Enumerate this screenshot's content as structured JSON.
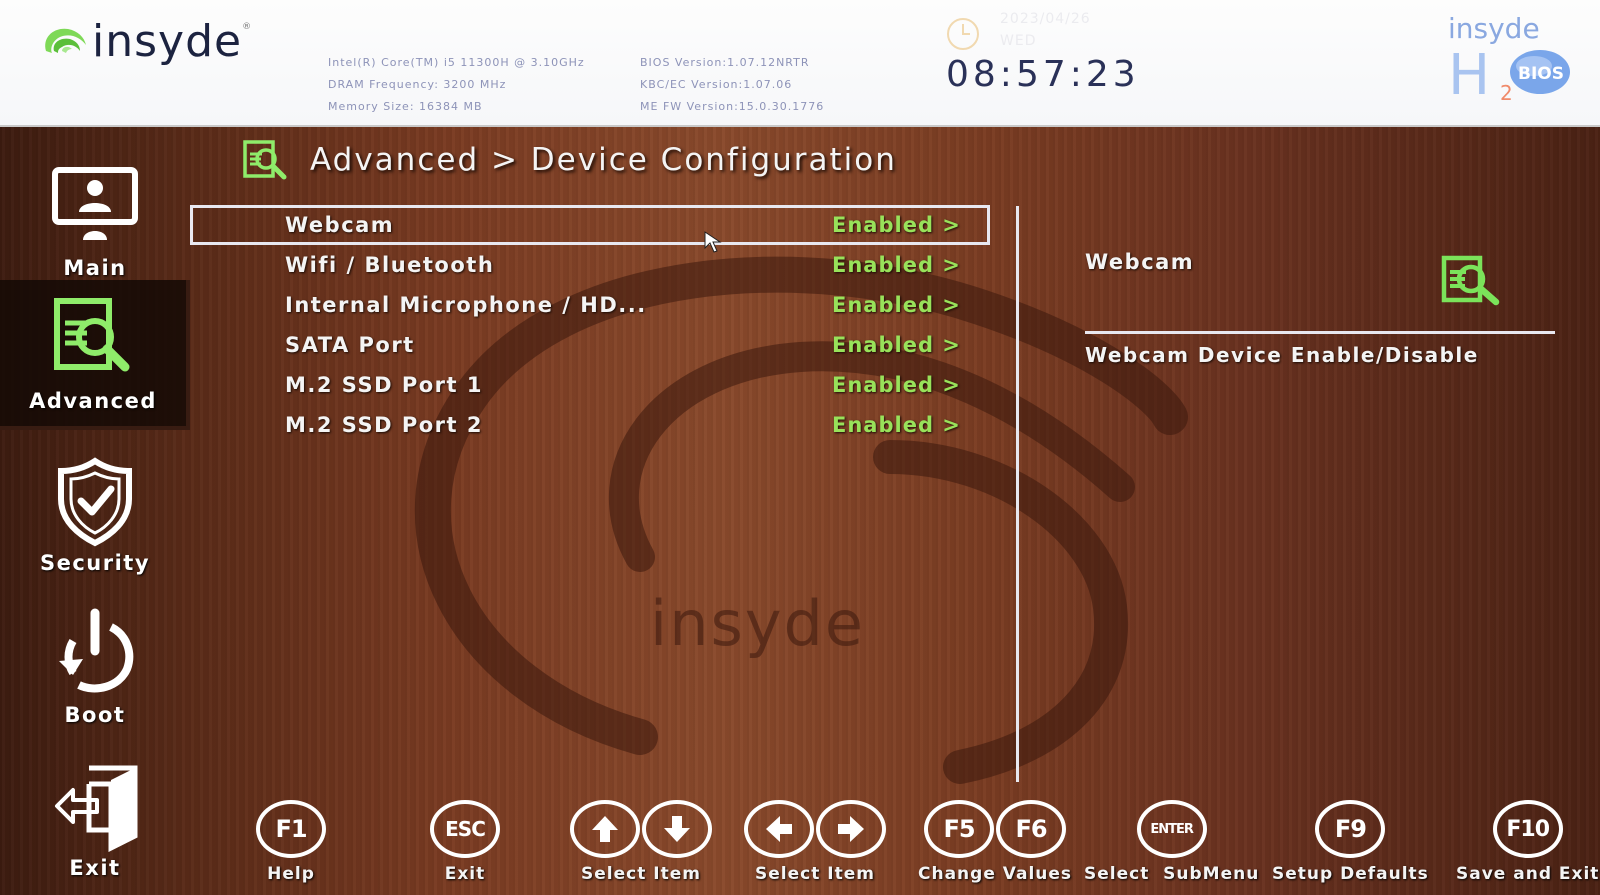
{
  "header": {
    "logo_text": "insyde",
    "logo_reg": "®",
    "sysinfo_left": [
      "Intel(R) Core(TM) i5 11300H @ 3.10GHz",
      "DRAM Frequency: 3200 MHz",
      "Memory Size: 16384 MB"
    ],
    "sysinfo_right": [
      "BIOS Version:1.07.12NRTR",
      "KBC/EC Version:1.07.06",
      "ME FW Version:15.0.30.1776"
    ],
    "date": "2023/04/26",
    "weekday": "WED",
    "time": "08:57:23",
    "product_logo": {
      "brand": "insyde",
      "h": "H",
      "sub": "2",
      "badge": "BIOS"
    }
  },
  "colors": {
    "accent_green": "#98e25a",
    "icon_green": "#7be35a",
    "text_white": "#f4f4f4",
    "time_navy": "#2a3158",
    "sysinfo_gray_blue": "#8d93b8"
  },
  "sidebar": {
    "items": [
      {
        "label": "Main",
        "icon": "monitor-user-icon",
        "active": false
      },
      {
        "label": "Advanced",
        "icon": "document-search-icon",
        "active": true
      },
      {
        "label": "Security",
        "icon": "shield-check-icon",
        "active": false
      },
      {
        "label": "Boot",
        "icon": "power-restart-icon",
        "active": false
      },
      {
        "label": "Exit",
        "icon": "door-exit-icon",
        "active": false
      }
    ]
  },
  "breadcrumb": {
    "text": "Advanced > Device Configuration",
    "icon": "document-search-icon"
  },
  "menu": {
    "items": [
      {
        "label": "Webcam",
        "value": "Enabled >",
        "selected": true
      },
      {
        "label": "Wifi / Bluetooth",
        "value": "Enabled >",
        "selected": false
      },
      {
        "label": "Internal Microphone / HD...",
        "value": "Enabled >",
        "selected": false
      },
      {
        "label": "SATA Port",
        "value": "Enabled >",
        "selected": false
      },
      {
        "label": "M.2 SSD Port 1",
        "value": "Enabled >",
        "selected": false
      },
      {
        "label": "M.2 SSD Port 2",
        "value": "Enabled >",
        "selected": false
      }
    ]
  },
  "help": {
    "title": "Webcam",
    "description": "Webcam Device Enable/Disable",
    "icon": "document-search-icon"
  },
  "watermark": {
    "text": "insyde"
  },
  "footer": {
    "keys": [
      {
        "keys": [
          "F1"
        ],
        "label": "Help"
      },
      {
        "keys": [
          "ESC"
        ],
        "label": "Exit"
      },
      {
        "keys": [
          "up-arrow",
          "down-arrow"
        ],
        "label": "Select Item"
      },
      {
        "keys": [
          "left-arrow",
          "right-arrow"
        ],
        "label": "Select Item"
      },
      {
        "keys": [
          "F5",
          "F6"
        ],
        "label": "Change Values"
      },
      {
        "keys": [
          "ENTER"
        ],
        "label": "Select  SubMenu"
      },
      {
        "keys": [
          "F9"
        ],
        "label": "Setup Defaults"
      },
      {
        "keys": [
          "F10"
        ],
        "label": "Save and Exit"
      }
    ]
  }
}
